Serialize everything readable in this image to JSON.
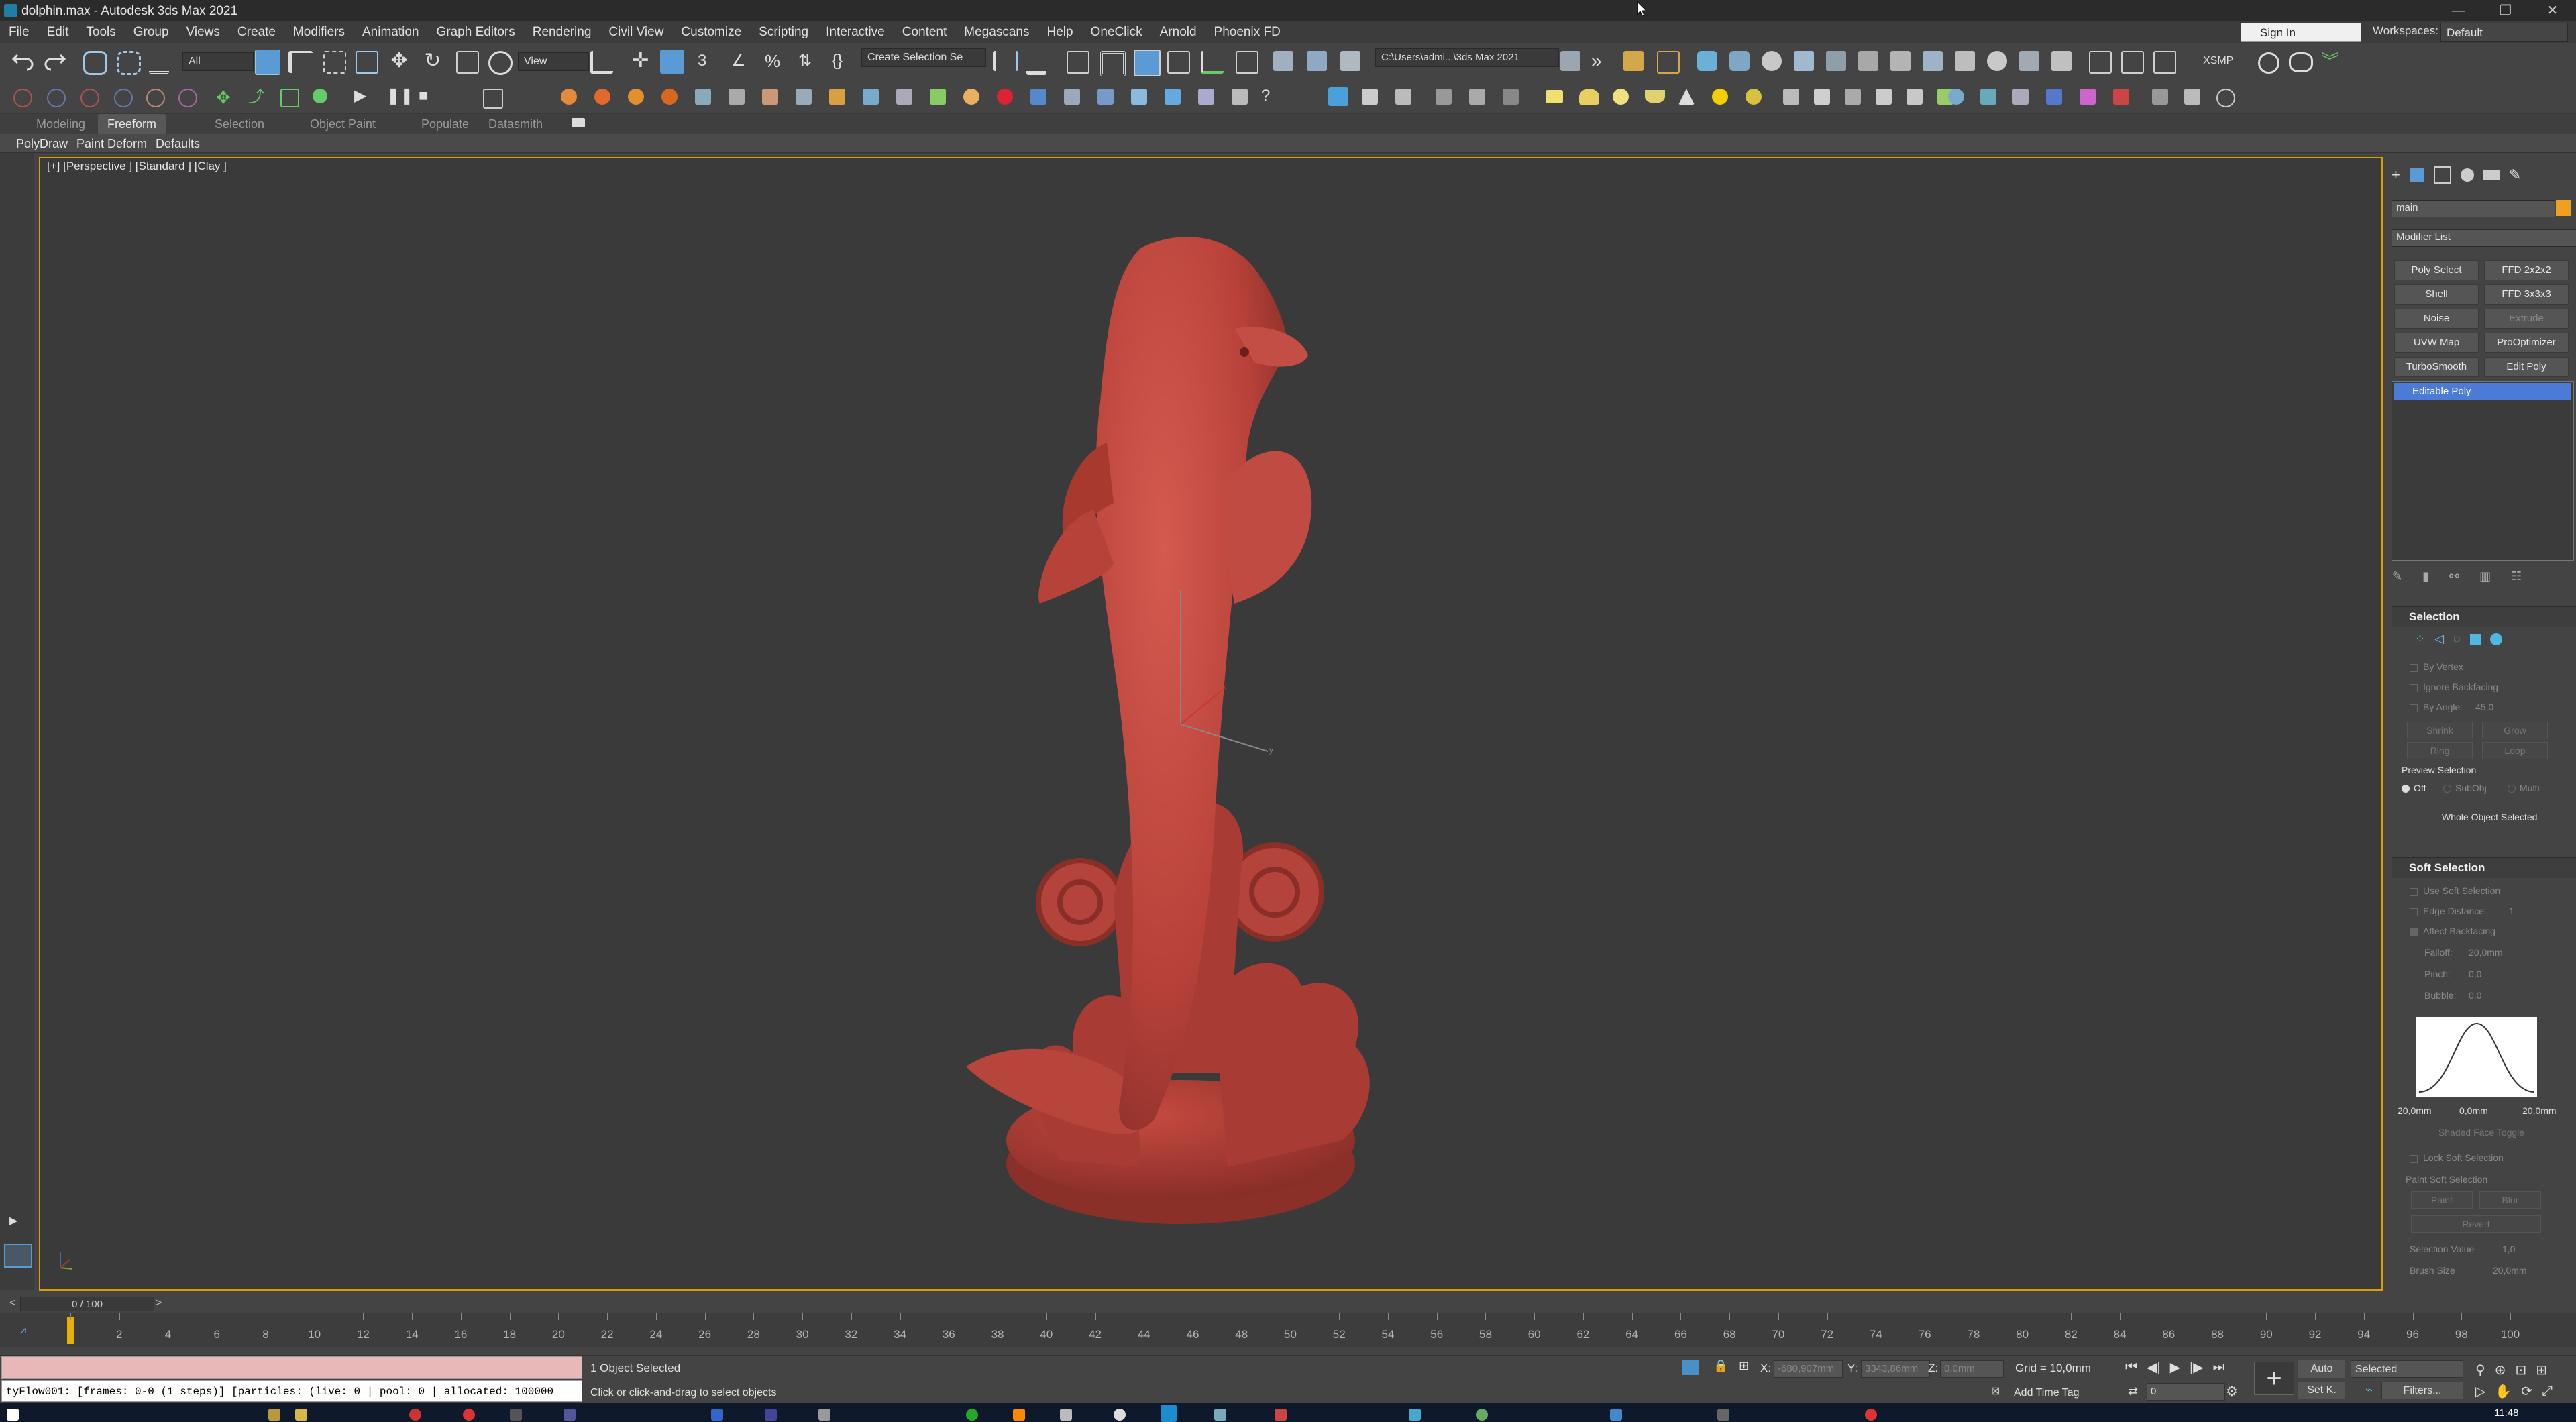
{
  "window": {
    "title": "dolphin.max - Autodesk 3ds Max 2021",
    "controls": [
      "—",
      "❐",
      "✕"
    ]
  },
  "menu": [
    "File",
    "Edit",
    "Tools",
    "Group",
    "Views",
    "Create",
    "Modifiers",
    "Animation",
    "Graph Editors",
    "Rendering",
    "Civil View",
    "Customize",
    "Scripting",
    "Interactive",
    "Content",
    "Megascans",
    "Help",
    "OneClick",
    "Arnold",
    "Phoenix FD"
  ],
  "account": {
    "signin": "Sign In",
    "workspaces_label": "Workspaces:",
    "workspace": "Default"
  },
  "toolbar": {
    "selection_filter": "All",
    "ref_coord": "View",
    "named_selection": "Create Selection Se",
    "project_path": "C:\\Users\\admi...\\3ds Max 2021",
    "xsmp": "XSMP"
  },
  "ribbon": {
    "tabs": [
      "Modeling",
      "Freeform",
      "Selection",
      "Object Paint",
      "Populate",
      "Datasmith"
    ],
    "active_tab": "Freeform",
    "sub_tabs": [
      "PolyDraw",
      "Paint Deform",
      "Defaults"
    ]
  },
  "viewport": {
    "label": "[+] [Perspective ] [Standard ] [Clay ]",
    "object_color": "#c4473e"
  },
  "command_panel": {
    "object_name": "main",
    "object_color": "#f0a020",
    "modifier_list": "Modifier List",
    "modifier_buttons": [
      "Poly Select",
      "FFD 2x2x2",
      "Shell",
      "FFD 3x3x3",
      "Noise",
      "Extrude",
      "UVW Map",
      "ProOptimizer",
      "TurboSmooth",
      "Edit Poly"
    ],
    "stack_item": "Editable Poly",
    "selection": {
      "title": "Selection",
      "by_vertex": "By Vertex",
      "ignore_backfacing": "Ignore Backfacing",
      "by_angle": "By Angle:",
      "by_angle_value": "45,0",
      "shrink": "Shrink",
      "grow": "Grow",
      "ring": "Ring",
      "loop": "Loop",
      "preview_selection": "Preview Selection",
      "preview_off": "Off",
      "preview_subobj": "SubObj",
      "preview_multi": "Multi",
      "status": "Whole Object Selected"
    },
    "soft_selection": {
      "title": "Soft Selection",
      "use_soft": "Use Soft Selection",
      "edge_distance": "Edge Distance:",
      "edge_distance_value": "1",
      "affect_backfacing": "Affect Backfacing",
      "falloff": "Falloff:",
      "falloff_value": "20,0mm",
      "pinch": "Pinch:",
      "pinch_value": "0,0",
      "bubble": "Bubble:",
      "bubble_value": "0,0",
      "curve_left": "20,0mm",
      "curve_mid": "0,0mm",
      "curve_right": "20,0mm",
      "shaded_face_toggle": "Shaded Face Toggle",
      "lock_soft": "Lock Soft Selection",
      "paint_soft": "Paint Soft Selection",
      "paint": "Paint",
      "blur": "Blur",
      "revert": "Revert",
      "selection_value": "Selection Value",
      "selection_value_v": "1,0",
      "brush_size": "Brush Size",
      "brush_size_v": "20,0mm"
    }
  },
  "timeline": {
    "slider": "0 / 100",
    "ticks": [
      0,
      2,
      4,
      6,
      8,
      10,
      12,
      14,
      16,
      18,
      20,
      22,
      24,
      26,
      28,
      30,
      32,
      34,
      36,
      38,
      40,
      42,
      44,
      46,
      48,
      50,
      52,
      54,
      56,
      58,
      60,
      62,
      64,
      66,
      68,
      70,
      72,
      74,
      76,
      78,
      80,
      82,
      84,
      86,
      88,
      90,
      92,
      94,
      96,
      98,
      100
    ]
  },
  "status": {
    "tyflow": "tyFlow001: [frames: 0-0 (1 steps)] [particles: (live: 0 | pool: 0 | allocated: 100000",
    "selected": "1 Object Selected",
    "prompt": "Click or click-and-drag to select objects",
    "x_label": "X:",
    "x_value": "-680,907mm",
    "y_label": "Y:",
    "y_value": "3343,86mm",
    "z_label": "Z:",
    "z_value": "0,0mm",
    "grid": "Grid = 10,0mm",
    "add_time_tag": "Add Time Tag",
    "auto": "Auto",
    "set_key": "Set K.",
    "selected_dd": "Selected",
    "filters": "Filters...",
    "frame": "0"
  },
  "taskbar": {
    "clock": "11:48"
  }
}
